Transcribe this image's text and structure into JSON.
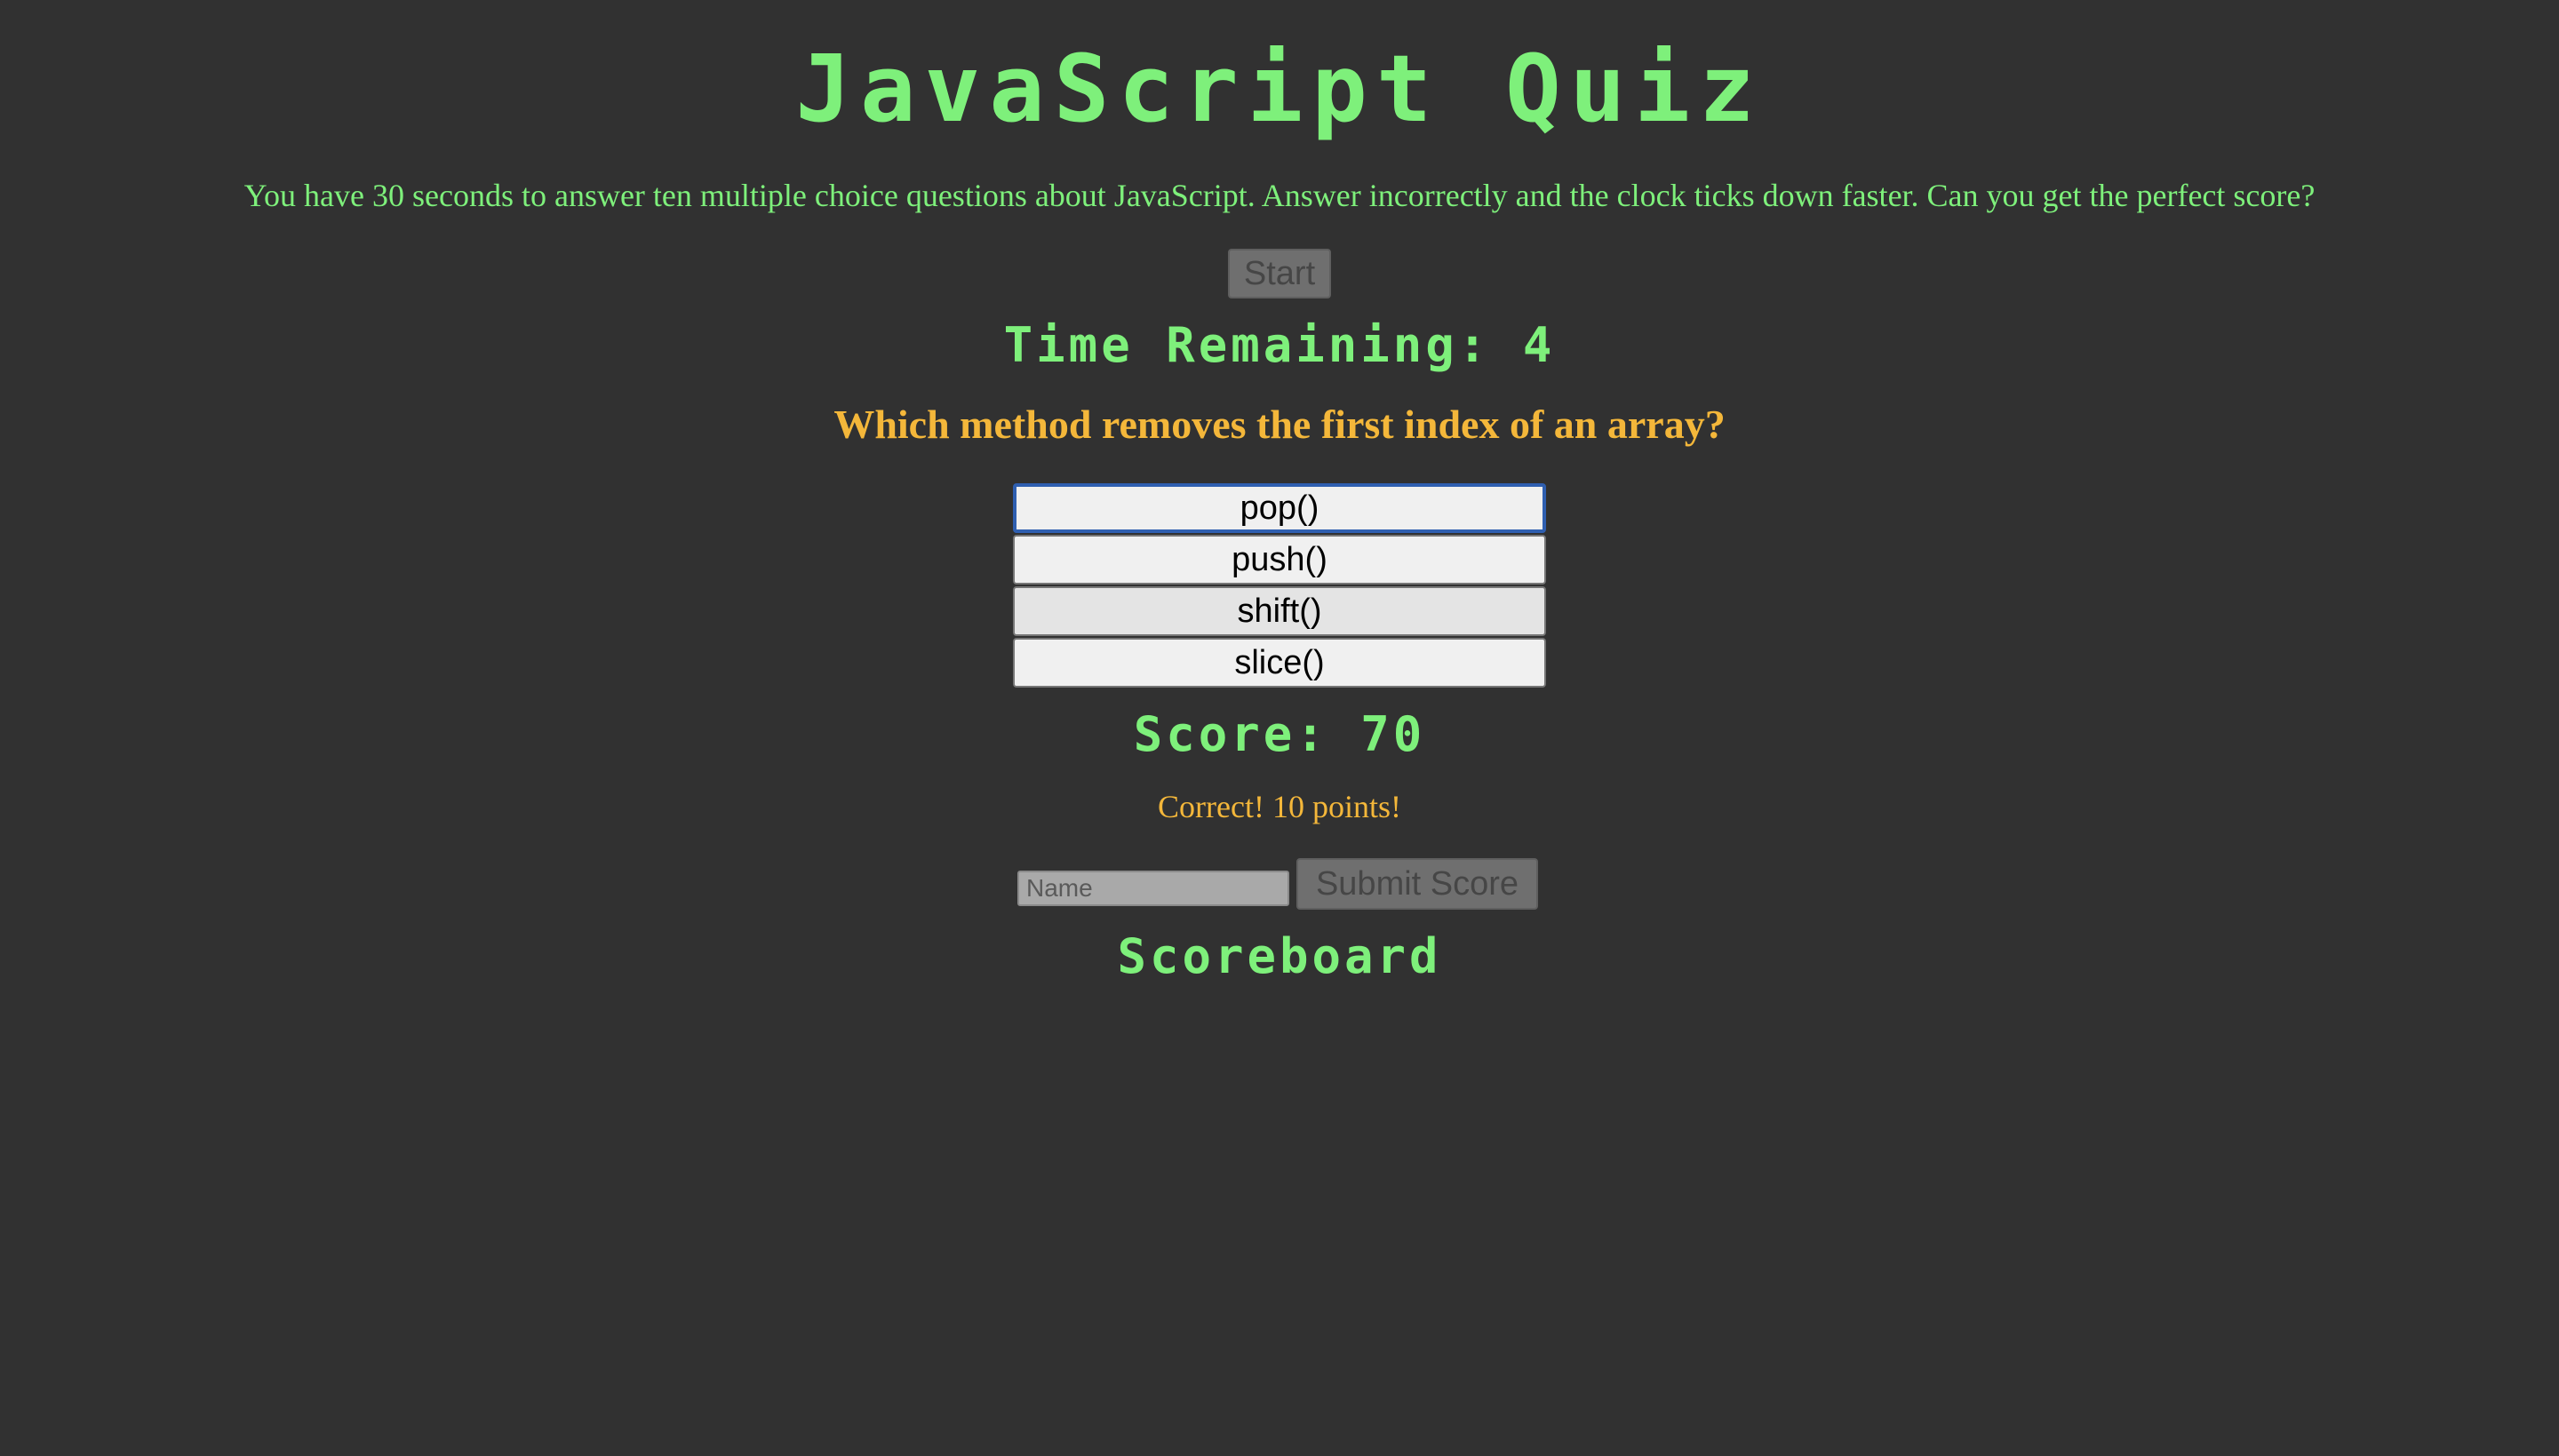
{
  "header": {
    "title": "JavaScript Quiz",
    "intro": "You have 30 seconds to answer ten multiple choice questions about JavaScript. Answer incorrectly and the clock ticks down faster. Can you get the perfect score?"
  },
  "controls": {
    "start_label": "Start"
  },
  "timer": {
    "text": "Time Remaining: 4"
  },
  "quiz": {
    "question": "Which method removes the first index of an array?",
    "choices": [
      {
        "label": "pop()"
      },
      {
        "label": "push()"
      },
      {
        "label": "shift()"
      },
      {
        "label": "slice()"
      }
    ]
  },
  "score": {
    "text": "Score: 70"
  },
  "feedback": {
    "text": "Correct! 10 points!"
  },
  "submit": {
    "name_placeholder": "Name",
    "submit_label": "Submit Score"
  },
  "scoreboard": {
    "title": "Scoreboard"
  },
  "colors": {
    "background": "#313131",
    "accent_green": "#7ef07b",
    "accent_orange": "#f4b73a",
    "focus_blue": "#2f5fb0"
  }
}
